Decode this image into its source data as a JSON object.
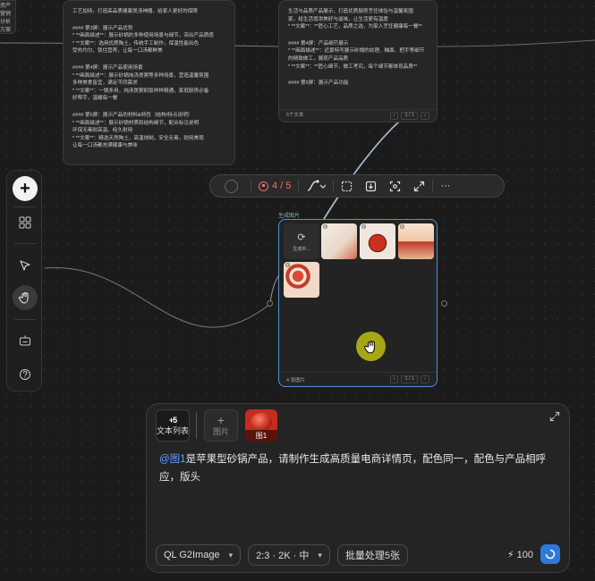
{
  "edge_card": {
    "lines": [
      "资产",
      "营销",
      "分析",
      "方案"
    ]
  },
  "card_a": {
    "lines": [
      "工艺加持，打造高品质健康煲汤神器，给家人更好的保障",
      "",
      "#### 第3屏：展示产品优势",
      "* **画面描述**：展示砂锅的多种使用场景与细节，突出产品质感",
      "* **文案**：选用优质陶土，传统手工制作，保温性能出色",
      "  受热均匀，锁住营养，让每一口汤都鲜美",
      "",
      "#### 第4屏：展示产品使用场景",
      "* **画面描述**：展示砂锅炖汤煲粥等多种场景，营造温馨氛围",
      "  多种美食皆宜，满足不同需求",
      "* **文案**：一锅多用，炖汤煲粥焖饭样样精通，家庭厨房必备",
      "  好帮手，温暖每一餐",
      "",
      "#### 第5屏：展示产品的材料&特性（结构/特点说明）",
      "* **画面描述**：展示砂锅材质和结构细节，配合标注说明",
      "  环保无毒耐高温，经久耐用",
      "* **文案**：精选天然陶土，高温烧制，安全无毒，耐用美观",
      "  让每一口汤都充满健康与美味"
    ]
  },
  "card_b": {
    "lines": [
      "生活与品质产品展示，打造优质厨房烹饪体验与温馨氛围",
      "家，给生活增添美好与滋味，让生活更有温度",
      "* **文案**：**匠心工艺，品质之选，为家人烹饪健康每一餐**",
      "",
      "#### 第4屏：产品细节展示",
      "* **画面描述**：近景特写展示砂锅的纹理、釉面、把手等细节",
      "  的精致做工，展现产品品质",
      "* **文案**：**匠心细节，做工考究，每个细节都体现品质**",
      "",
      "#### 第5屏：展示产品功能"
    ],
    "footer_left": "5个文本",
    "footer_pager": "1 / 1"
  },
  "toolbar": {
    "counter": "4 / 5"
  },
  "gen_card": {
    "label": "生成图片",
    "loading_text": "生成中...",
    "footer_left": "4 张图片",
    "footer_pager": "1 / 1"
  },
  "composer": {
    "chip_textlist_badge": "+5",
    "chip_textlist_label": "文本列表",
    "chip_addimg_label": "图片",
    "chip_ref_label": "图1",
    "prompt_mention": "@图1",
    "prompt_text": "是苹果型砂锅产品，请制作生成高质量电商详情页，配色同一，配色与产品相呼应，版头",
    "model": "QL G2Image",
    "params": "2:3 · 2K · 中",
    "batch": "批量处理5张",
    "credits": "100"
  },
  "colors": {
    "accent_blue": "#2f7ad9",
    "selection_border": "#4e92d6",
    "stop_red": "#f36b6b",
    "cursor_yellow": "#bebe14"
  }
}
